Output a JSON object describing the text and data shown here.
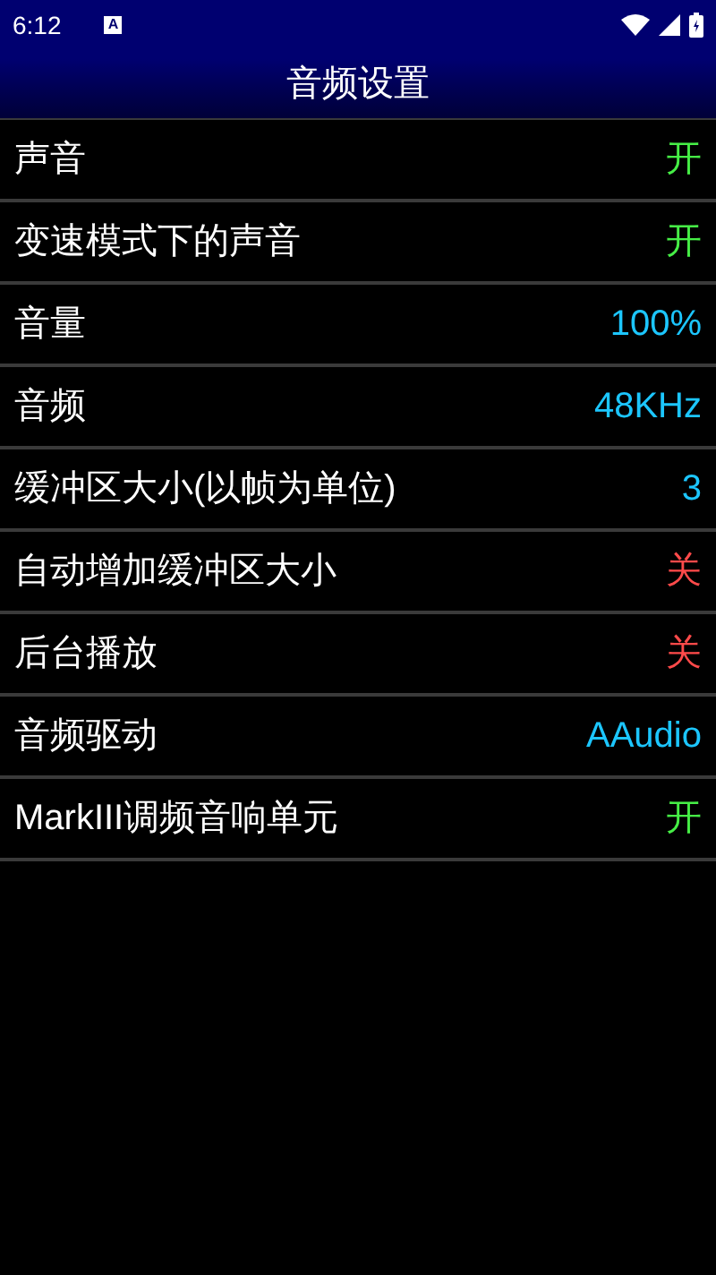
{
  "status_bar": {
    "time": "6:12",
    "notification": "A"
  },
  "title": "音频设置",
  "settings": [
    {
      "label": "声音",
      "kind": "toggle",
      "on": true,
      "value": "开"
    },
    {
      "label": "变速模式下的声音",
      "kind": "toggle",
      "on": true,
      "value": "开"
    },
    {
      "label": "音量",
      "kind": "value",
      "value": "100%"
    },
    {
      "label": "音频",
      "kind": "value",
      "value": "48KHz"
    },
    {
      "label": "缓冲区大小(以帧为单位)",
      "kind": "value",
      "value": "3"
    },
    {
      "label": "自动增加缓冲区大小",
      "kind": "toggle",
      "on": false,
      "value": "关"
    },
    {
      "label": "后台播放",
      "kind": "toggle",
      "on": false,
      "value": "关"
    },
    {
      "label": "音频驱动",
      "kind": "value",
      "value": "AAudio"
    },
    {
      "label": "MarkIII调频音响单元",
      "kind": "toggle",
      "on": true,
      "value": "开"
    }
  ]
}
